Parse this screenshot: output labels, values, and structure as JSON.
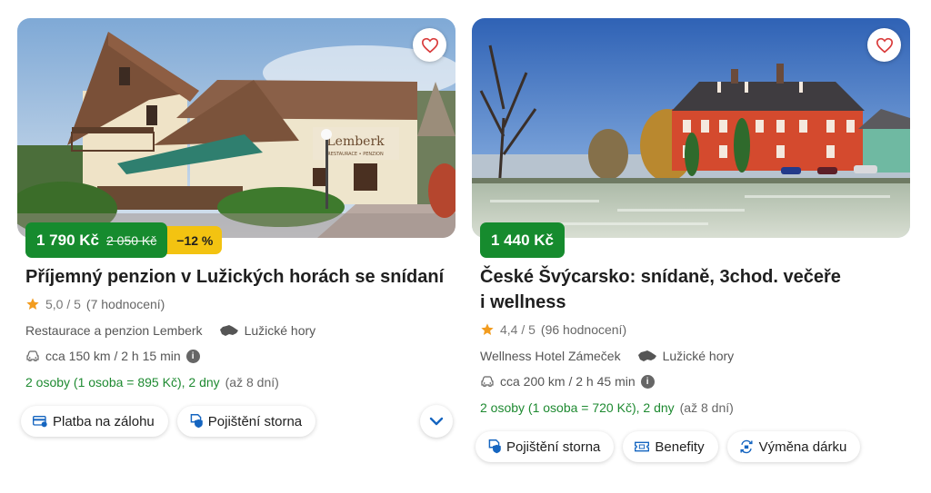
{
  "cards": [
    {
      "price_now": "1 790 Kč",
      "price_old": "2 050 Kč",
      "discount": "−12 %",
      "title": "Příjemný penzion v Lužických horách se snídaní",
      "rating_score": "5,0 / 5",
      "rating_count": "(7 hodnocení)",
      "venue": "Restaurace a penzion Lemberk",
      "region": "Lužické hory",
      "travel": "cca 150 km / 2 h 15 min",
      "stay": "2 osoby (1 osoba = 895 Kč), 2 dny",
      "stay_extra": "(až 8 dní)",
      "chips": [
        "Platba na zálohu",
        "Pojištění storna"
      ],
      "sign_text": "Lemberk",
      "sign_sub": "RESTAURACE • PENZION"
    },
    {
      "price_now": "1 440 Kč",
      "title_line1": "České Švýcarsko: snídaně, 3chod. večeře",
      "title_line2": "i wellness",
      "rating_score": "4,4 / 5",
      "rating_count": "(96 hodnocení)",
      "venue": "Wellness Hotel Zámeček",
      "region": "Lužické hory",
      "travel": "cca 200 km / 2 h 45 min",
      "stay": "2 osoby (1 osoba = 720 Kč), 2 dny",
      "stay_extra": "(až 8 dní)",
      "chips": [
        "Pojištění storna",
        "Benefity",
        "Výměna dárku"
      ]
    }
  ],
  "colors": {
    "price_green": "#168b2e",
    "discount_yellow": "#f3c311",
    "stay_green": "#1e8a31",
    "star_orange": "#f29c1f",
    "heart_red": "#d93a3a",
    "chip_blue": "#1565c0"
  },
  "icons": {
    "favorite": "heart-outline-icon",
    "rating": "star-icon",
    "region": "czech-map-icon",
    "travel": "car-icon",
    "info": "info-icon",
    "deposit": "card-payment-icon",
    "insurance": "shield-document-icon",
    "benefits": "ticket-icon",
    "exchange": "gift-exchange-icon",
    "expand": "chevron-down-icon"
  }
}
